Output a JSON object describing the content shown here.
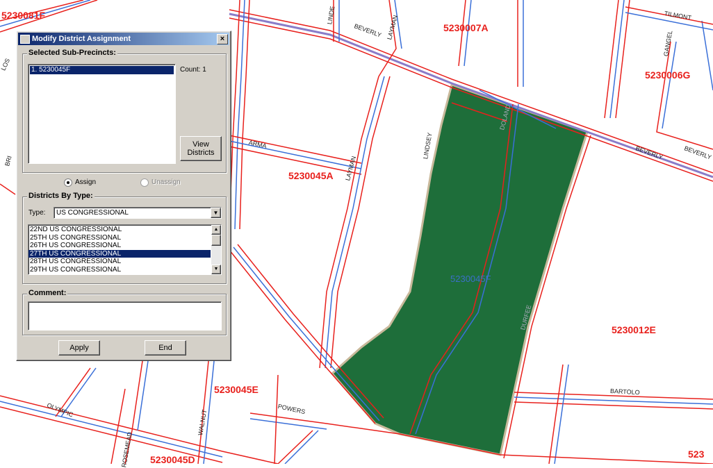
{
  "map": {
    "precinct_labels": [
      {
        "id": "5230081F",
        "text": "5230081F"
      },
      {
        "id": "5230007A",
        "text": "5230007A"
      },
      {
        "id": "5230006G",
        "text": "5230006G"
      },
      {
        "id": "5230045A",
        "text": "5230045A"
      },
      {
        "id": "5230012E",
        "text": "5230012E"
      },
      {
        "id": "5230045E",
        "text": "5230045E"
      },
      {
        "id": "5230045D",
        "text": "5230045D"
      },
      {
        "id": "5230edge",
        "text": "523"
      }
    ],
    "selected_polygon_label": "5230045F",
    "streets": {
      "tilmont": "TILMONT",
      "beverly_top": "BEVERLY",
      "layman_top": "LAYMAN",
      "linde": "LINDE",
      "gangel": "GANGEL",
      "beverly_right": "BEVERLY",
      "beverly_right2": "BEVERLY",
      "arma": "ARMA",
      "layman": "LAYMAN",
      "lindsey": "LINDSEY",
      "dorand": "DOLAND",
      "durfee": "DURFEE",
      "bartolo": "BARTOLO",
      "olympic": "OLYMPIC",
      "powers": "POWERS",
      "walnut": "WALNUT",
      "rosemead": "ROSEMEAD",
      "los": "LOS",
      "bri": "BRI"
    },
    "colors": {
      "polygon": "#1e6e3a",
      "road_red": "#e8201c",
      "road_blue": "#3a6fd8",
      "highway": "#8a7cc8"
    }
  },
  "dialog": {
    "title": "Modify District Assignment",
    "close_label": "×",
    "selected_group_label": "Selected Sub-Precincts:",
    "sub_precincts": [
      "1. 5230045F"
    ],
    "count_text": "Count: 1",
    "view_districts_label_1": "View",
    "view_districts_label_2": "Districts",
    "assign_label": "Assign",
    "unassign_label": "Unassign",
    "districts_group_label": "Districts By Type:",
    "type_label": "Type:",
    "type_value": "US CONGRESSIONAL",
    "districts": [
      "22ND US CONGRESSIONAL",
      "25TH US CONGRESSIONAL",
      "26TH US CONGRESSIONAL",
      "27TH US CONGRESSIONAL",
      "28TH US CONGRESSIONAL",
      "29TH US CONGRESSIONAL"
    ],
    "selected_district_index": 3,
    "comment_group_label": "Comment:",
    "comment_value": "",
    "apply_label": "Apply",
    "end_label": "End"
  }
}
